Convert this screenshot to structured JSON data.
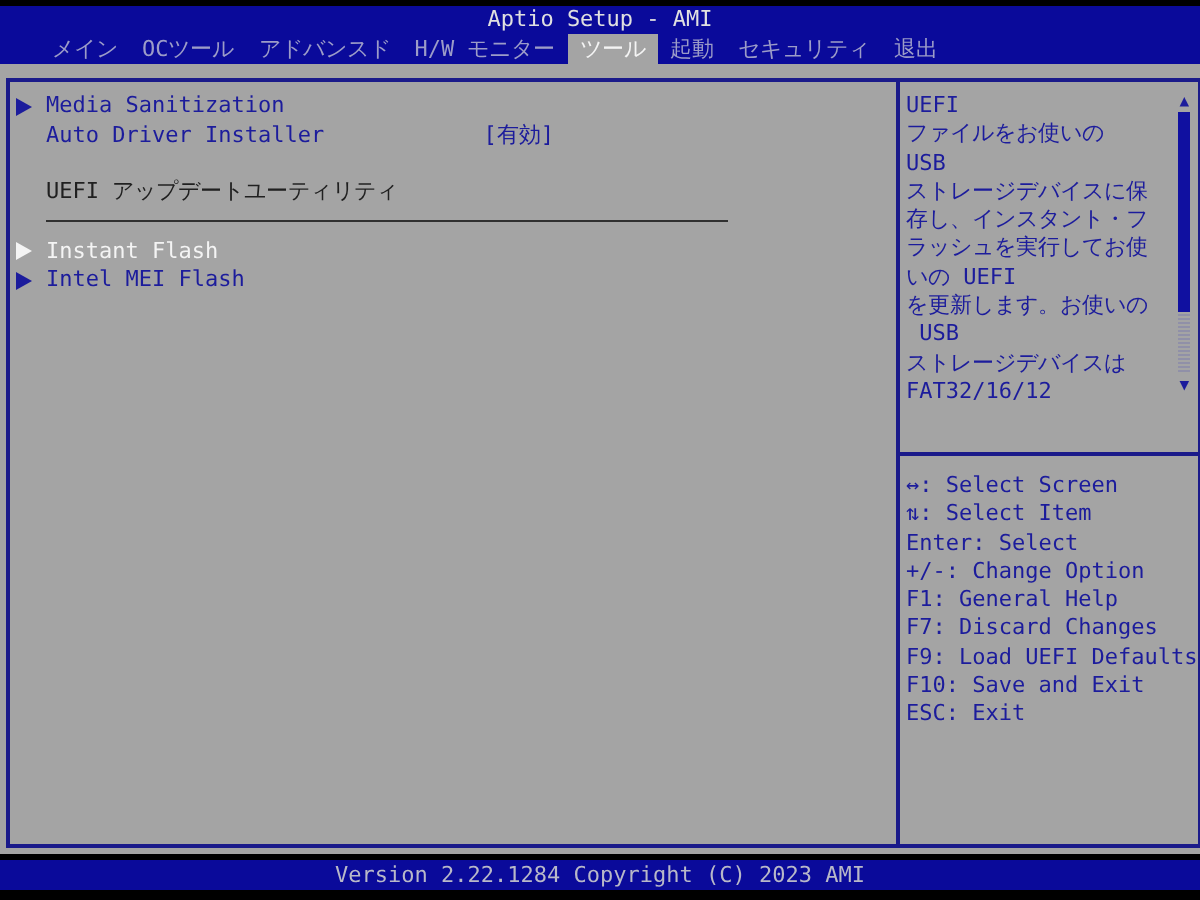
{
  "window": {
    "title": "Aptio Setup - AMI"
  },
  "tabs": [
    {
      "label": "メイン",
      "selected": false
    },
    {
      "label": "OCツール",
      "selected": false
    },
    {
      "label": "アドバンスド",
      "selected": false
    },
    {
      "label": "H/W モニター",
      "selected": false
    },
    {
      "label": "ツール",
      "selected": true
    },
    {
      "label": "起動",
      "selected": false
    },
    {
      "label": "セキュリティ",
      "selected": false
    },
    {
      "label": "退出",
      "selected": false
    }
  ],
  "items": [
    {
      "kind": "submenu",
      "label": "Media Sanitization",
      "selected": false
    },
    {
      "kind": "setting",
      "label": "Auto Driver Installer",
      "value": "[有効]",
      "selected": false
    },
    {
      "kind": "section",
      "label": "UEFI アップデートユーティリティ"
    },
    {
      "kind": "submenu",
      "label": "Instant Flash",
      "selected": true
    },
    {
      "kind": "submenu",
      "label": "Intel MEI Flash",
      "selected": false
    }
  ],
  "help": {
    "lines": [
      "UEFI",
      "ファイルをお使いの",
      "USB",
      "ストレージデバイスに保",
      "存し、インスタント・フ",
      "ラッシュを実行してお使",
      "いの UEFI",
      "を更新します。お使いの",
      " USB",
      "ストレージデバイスは",
      "FAT32/16/12"
    ],
    "scroll_up": "▲",
    "scroll_down": "▼"
  },
  "keys": [
    "↔: Select Screen",
    "⇅: Select Item",
    "Enter: Select",
    "+/-: Change Option",
    "F1: General Help",
    "F7: Discard Changes",
    "F9: Load UEFI Defaults",
    "F10: Save and Exit",
    "ESC: Exit"
  ],
  "footer": "Version 2.22.1284 Copyright (C) 2023 AMI"
}
